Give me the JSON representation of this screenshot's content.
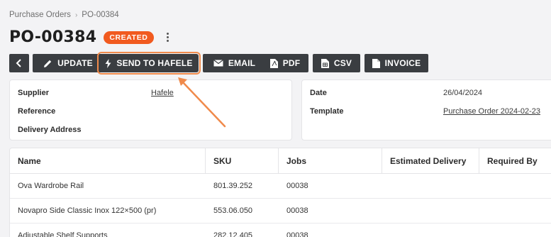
{
  "breadcrumb": {
    "parent": "Purchase Orders",
    "separator": "›",
    "current": "PO-00384"
  },
  "header": {
    "title": "PO-00384",
    "status": "CREATED"
  },
  "toolbar": {
    "update": "UPDATE",
    "send": "SEND TO HAFELE",
    "email": "EMAIL",
    "pdf": "PDF",
    "csv": "CSV",
    "invoice": "INVOICE"
  },
  "details": {
    "supplier_label": "Supplier",
    "supplier_value": "Hafele",
    "reference_label": "Reference",
    "delivery_label": "Delivery Address",
    "date_label": "Date",
    "date_value": "26/04/2024",
    "template_label": "Template",
    "template_value": "Purchase Order 2024-02-23"
  },
  "table": {
    "columns": [
      "Name",
      "SKU",
      "Jobs",
      "Estimated Delivery",
      "Required By"
    ],
    "rows": [
      {
        "name": "Ova Wardrobe Rail",
        "sku": "801.39.252",
        "jobs": "00038",
        "est": "",
        "req": ""
      },
      {
        "name": "Novapro Side Classic Inox 122×500 (pr)",
        "sku": "553.06.050",
        "jobs": "00038",
        "est": "",
        "req": ""
      },
      {
        "name": "Adjustable Shelf Supports",
        "sku": "282.12.405",
        "jobs": "00038",
        "est": "",
        "req": ""
      }
    ]
  },
  "colors": {
    "accent": "#f15a1f",
    "button": "#3a3d41",
    "highlight": "#f08a4b"
  }
}
